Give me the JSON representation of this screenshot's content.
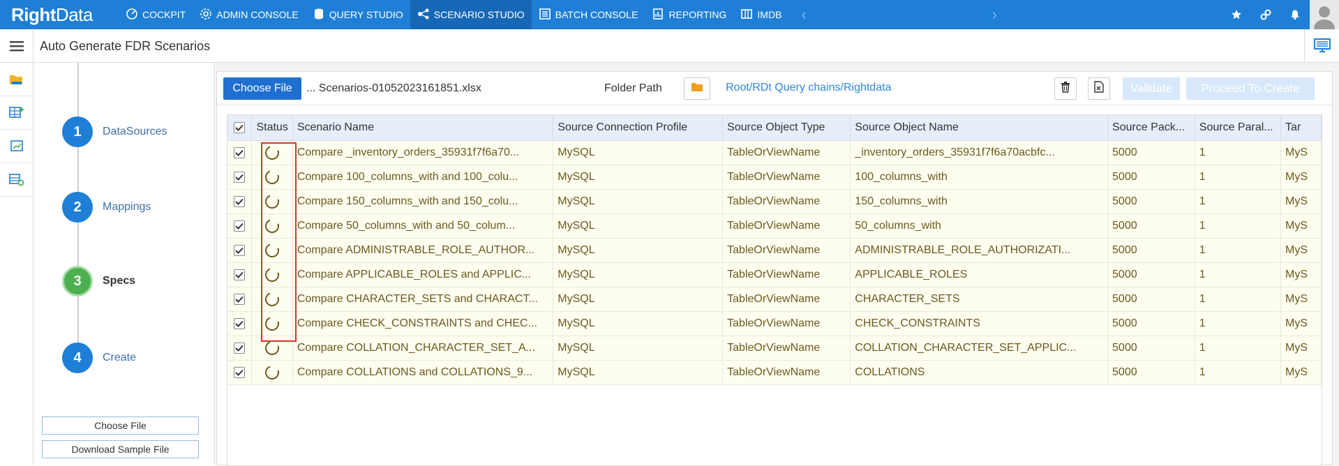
{
  "app": {
    "logo_main": "Right",
    "logo_accent": "Data",
    "nav": [
      {
        "label": "COCKPIT",
        "icon": "cockpit-icon"
      },
      {
        "label": "ADMIN CONSOLE",
        "icon": "gear-icon"
      },
      {
        "label": "QUERY STUDIO",
        "icon": "database-icon"
      },
      {
        "label": "SCENARIO STUDIO",
        "icon": "scenario-icon",
        "active": true
      },
      {
        "label": "BATCH CONSOLE",
        "icon": "batch-icon"
      },
      {
        "label": "REPORTING",
        "icon": "report-icon"
      },
      {
        "label": "IMDB",
        "icon": "imdb-icon"
      }
    ]
  },
  "header": {
    "title": "Auto Generate FDR Scenarios"
  },
  "stepper": {
    "steps": [
      {
        "number": "1",
        "label": "DataSources"
      },
      {
        "number": "2",
        "label": "Mappings"
      },
      {
        "number": "3",
        "label": "Specs",
        "current": true
      },
      {
        "number": "4",
        "label": "Create"
      }
    ],
    "choose_file": "Choose File",
    "download_sample": "Download Sample File"
  },
  "toolbar": {
    "choose_file": "Choose File",
    "filename": "... Scenarios-01052023161851.xlsx",
    "folder_label": "Folder Path",
    "folder_path": "Root/RDt Query chains/Rightdata",
    "validate": "Validate",
    "proceed": "Proceed To Create"
  },
  "grid": {
    "columns": [
      "Status",
      "Scenario Name",
      "Source Connection Profile",
      "Source Object Type",
      "Source Object Name",
      "Source Pack...",
      "Source Paral...",
      "Tar"
    ],
    "rows": [
      {
        "scenario": "Compare _inventory_orders_35931f7f6a70...",
        "profile": "MySQL",
        "type": "TableOrViewName",
        "object": "_inventory_orders_35931f7f6a70acbfc...",
        "pack": "5000",
        "parallel": "1",
        "target": "MyS"
      },
      {
        "scenario": "Compare 100_columns_with and 100_colu...",
        "profile": "MySQL",
        "type": "TableOrViewName",
        "object": "100_columns_with",
        "pack": "5000",
        "parallel": "1",
        "target": "MyS"
      },
      {
        "scenario": "Compare 150_columns_with and 150_colu...",
        "profile": "MySQL",
        "type": "TableOrViewName",
        "object": "150_columns_with",
        "pack": "5000",
        "parallel": "1",
        "target": "MyS"
      },
      {
        "scenario": "Compare 50_columns_with and 50_colum...",
        "profile": "MySQL",
        "type": "TableOrViewName",
        "object": "50_columns_with",
        "pack": "5000",
        "parallel": "1",
        "target": "MyS"
      },
      {
        "scenario": "Compare ADMINISTRABLE_ROLE_AUTHOR...",
        "profile": "MySQL",
        "type": "TableOrViewName",
        "object": "ADMINISTRABLE_ROLE_AUTHORIZATI...",
        "pack": "5000",
        "parallel": "1",
        "target": "MyS"
      },
      {
        "scenario": "Compare APPLICABLE_ROLES and APPLIC...",
        "profile": "MySQL",
        "type": "TableOrViewName",
        "object": "APPLICABLE_ROLES",
        "pack": "5000",
        "parallel": "1",
        "target": "MyS"
      },
      {
        "scenario": "Compare CHARACTER_SETS and CHARACT...",
        "profile": "MySQL",
        "type": "TableOrViewName",
        "object": "CHARACTER_SETS",
        "pack": "5000",
        "parallel": "1",
        "target": "MyS"
      },
      {
        "scenario": "Compare CHECK_CONSTRAINTS and CHEC...",
        "profile": "MySQL",
        "type": "TableOrViewName",
        "object": "CHECK_CONSTRAINTS",
        "pack": "5000",
        "parallel": "1",
        "target": "MyS"
      },
      {
        "scenario": "Compare COLLATION_CHARACTER_SET_A...",
        "profile": "MySQL",
        "type": "TableOrViewName",
        "object": "COLLATION_CHARACTER_SET_APPLIC...",
        "pack": "5000",
        "parallel": "1",
        "target": "MyS"
      },
      {
        "scenario": "Compare COLLATIONS and COLLATIONS_9...",
        "profile": "MySQL",
        "type": "TableOrViewName",
        "object": "COLLATIONS",
        "pack": "5000",
        "parallel": "1",
        "target": "MyS"
      }
    ]
  }
}
